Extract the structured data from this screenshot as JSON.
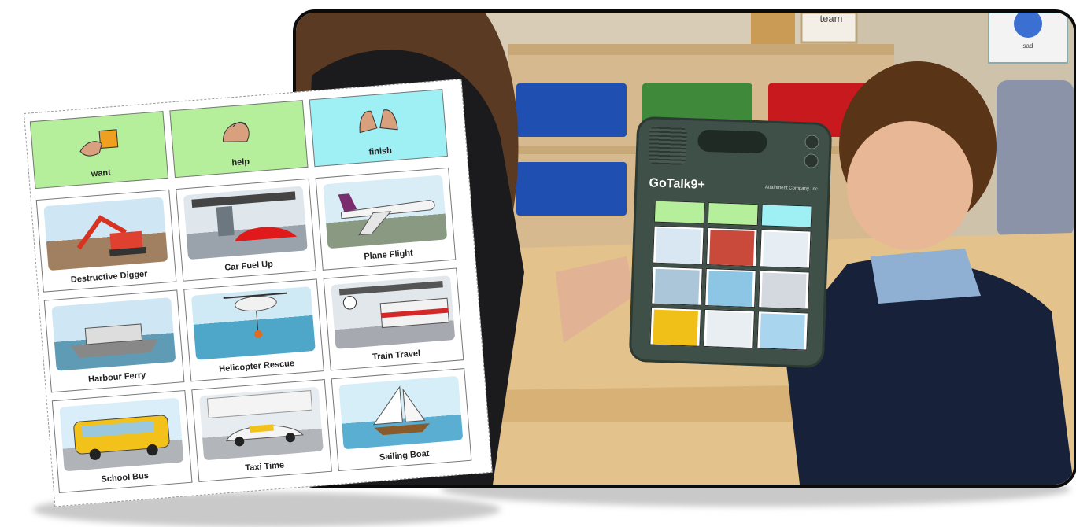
{
  "board": {
    "top_row": [
      {
        "label": "want",
        "color": "#b6ef9c"
      },
      {
        "label": "help",
        "color": "#b6ef9c"
      },
      {
        "label": "finish",
        "color": "#9ef0f5"
      }
    ],
    "cards": [
      {
        "label": "Destructive Digger"
      },
      {
        "label": "Car Fuel Up"
      },
      {
        "label": "Plane Flight"
      },
      {
        "label": "Harbour Ferry"
      },
      {
        "label": "Helicopter Rescue"
      },
      {
        "label": "Train Travel"
      },
      {
        "label": "School Bus"
      },
      {
        "label": "Taxi Time"
      },
      {
        "label": "Sailing Boat"
      }
    ]
  },
  "photo": {
    "wall_signs": [
      "team",
      "sad"
    ],
    "device": {
      "logo": "GoTalk9+",
      "brand": "Attainment Company, Inc."
    }
  },
  "colors": {
    "want": "#b6ef9c",
    "finish": "#9ef0f5",
    "device": "#3f5048"
  }
}
